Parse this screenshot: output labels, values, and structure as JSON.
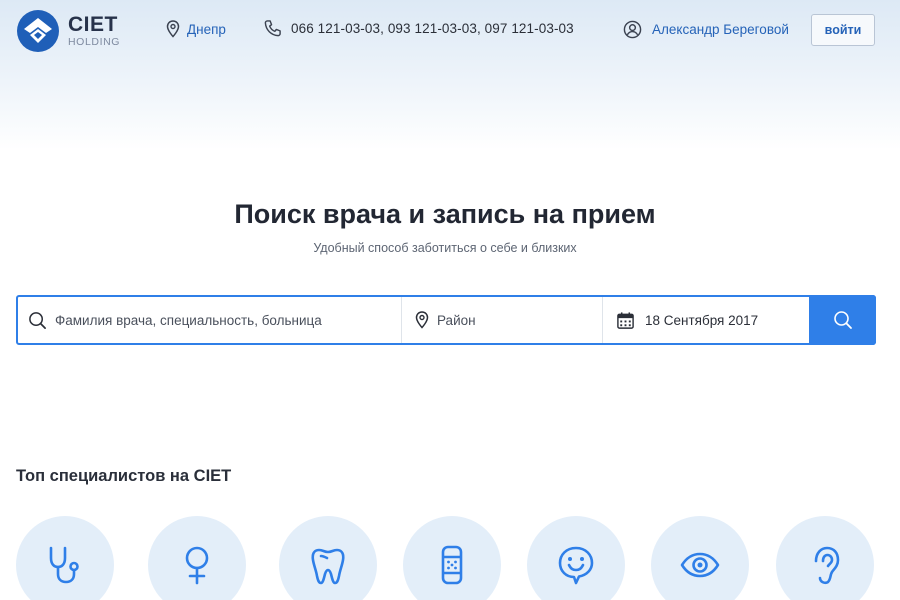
{
  "header": {
    "logo": {
      "name": "CIET",
      "sub": "HOLDING"
    },
    "city": "Днепр",
    "phones": "066 121-03-03, 093 121-03-03, 097 121-03-03",
    "user_name": "Александр Береговой",
    "login_label": "войти"
  },
  "hero": {
    "title": "Поиск врача и запись на прием",
    "subtitle": "Удобный способ заботиться о себе и близких"
  },
  "search": {
    "query_placeholder": "Фамилия врача, специальность, больница",
    "district_placeholder": "Район",
    "date": "18 Сентября 2017"
  },
  "specialists_section": {
    "title": "Топ специалистов на CIET",
    "icons": [
      "stethoscope-icon",
      "female-symbol-icon",
      "tooth-icon",
      "bandage-icon",
      "smiley-icon",
      "eye-icon",
      "ear-icon"
    ]
  },
  "colors": {
    "accent": "#2f7fe8",
    "link": "#2563b8",
    "logo_blue": "#1f5fb8",
    "circle_bg": "#e3eef9"
  }
}
